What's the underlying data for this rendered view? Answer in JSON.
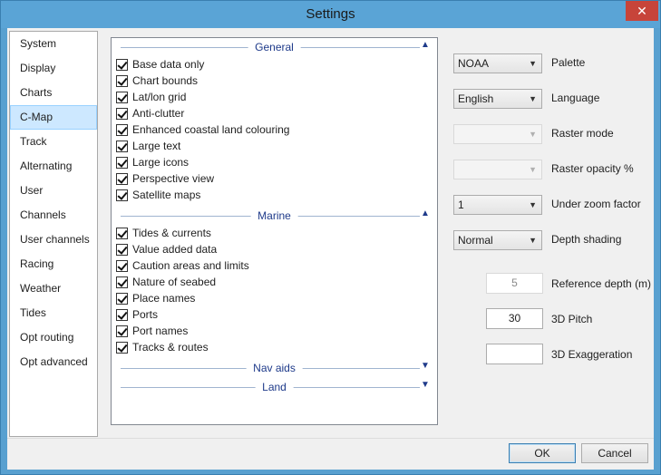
{
  "window": {
    "title": "Settings"
  },
  "nav": {
    "items": [
      {
        "label": "System"
      },
      {
        "label": "Display"
      },
      {
        "label": "Charts"
      },
      {
        "label": "C-Map",
        "selected": true
      },
      {
        "label": "Track"
      },
      {
        "label": "Alternating"
      },
      {
        "label": "User"
      },
      {
        "label": "Channels"
      },
      {
        "label": "User channels"
      },
      {
        "label": "Racing"
      },
      {
        "label": "Weather"
      },
      {
        "label": "Tides"
      },
      {
        "label": "Opt routing"
      },
      {
        "label": "Opt advanced"
      }
    ]
  },
  "sections": {
    "general": {
      "title": "General",
      "state": "expanded",
      "items": [
        {
          "label": "Base data only",
          "checked": true
        },
        {
          "label": "Chart bounds",
          "checked": true
        },
        {
          "label": "Lat/lon grid",
          "checked": true
        },
        {
          "label": "Anti-clutter",
          "checked": true
        },
        {
          "label": "Enhanced coastal land colouring",
          "checked": true
        },
        {
          "label": "Large text",
          "checked": true
        },
        {
          "label": "Large icons",
          "checked": true
        },
        {
          "label": "Perspective view",
          "checked": true
        },
        {
          "label": "Satellite maps",
          "checked": true
        }
      ]
    },
    "marine": {
      "title": "Marine",
      "state": "expanded",
      "items": [
        {
          "label": "Tides & currents",
          "checked": true
        },
        {
          "label": "Value added data",
          "checked": true
        },
        {
          "label": "Caution areas and limits",
          "checked": true
        },
        {
          "label": "Nature of seabed",
          "checked": true
        },
        {
          "label": "Place names",
          "checked": true
        },
        {
          "label": "Ports",
          "checked": true
        },
        {
          "label": "Port names",
          "checked": true
        },
        {
          "label": "Tracks & routes",
          "checked": true
        }
      ]
    },
    "navaids": {
      "title": "Nav aids",
      "state": "collapsed"
    },
    "land": {
      "title": "Land",
      "state": "collapsed"
    }
  },
  "settings": {
    "palette": {
      "value": "NOAA",
      "label": "Palette"
    },
    "language": {
      "value": "English",
      "label": "Language"
    },
    "raster_mode": {
      "value": "",
      "label": "Raster mode"
    },
    "raster_opacity": {
      "value": "",
      "label": "Raster opacity %"
    },
    "under_zoom": {
      "value": "1",
      "label": "Under zoom factor"
    },
    "depth_shading": {
      "value": "Normal",
      "label": "Depth shading"
    },
    "reference_depth": {
      "value": "5",
      "label": "Reference depth (m)"
    },
    "pitch_3d": {
      "value": "30",
      "label": "3D Pitch"
    },
    "exaggeration_3d": {
      "value": "",
      "label": "3D Exaggeration"
    }
  },
  "buttons": {
    "ok": "OK",
    "cancel": "Cancel"
  },
  "icons": {
    "close": "close-icon",
    "expand": "chevron-up-icon",
    "collapse": "chevron-down-icon",
    "dropdown": "chevron-down-icon"
  },
  "colors": {
    "titlebar": "#5aa4d6",
    "close": "#c7443a",
    "section_title": "#1e3a8a",
    "selected_nav": "#cde8ff"
  }
}
